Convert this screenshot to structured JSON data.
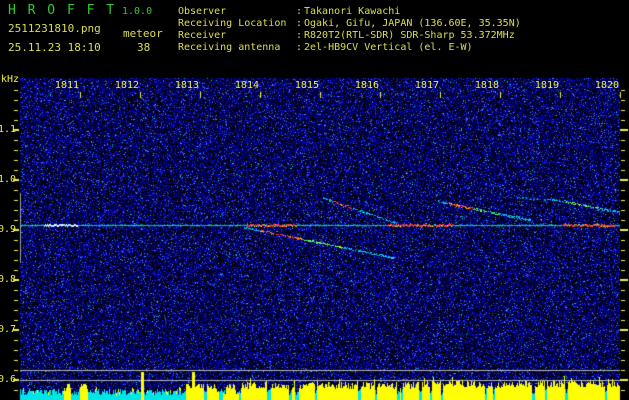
{
  "header": {
    "app_title": "H R O F F T",
    "version": "1.0.0",
    "filename": "2511231810.png",
    "mode_label": "meteor",
    "timestamp": "25.11.23 18:10",
    "meteor_count": "38",
    "separator": ":",
    "station_info": [
      {
        "label": "Observer",
        "value": "Takanori Kawachi"
      },
      {
        "label": "Receiving Location",
        "value": "Ogaki, Gifu, JAPAN (136.60E, 35.35N)"
      },
      {
        "label": "Receiver",
        "value": "R820T2(RTL-SDR) SDR-Sharp 53.372MHz"
      },
      {
        "label": "Receiving antenna",
        "value": "2el-HB9CV Vertical (el. E-W)"
      }
    ]
  },
  "colors": {
    "title_green": "#2ecc2e",
    "text_yellow": "#dddd55",
    "axis_yellow": "#f0f040",
    "background": "#000000",
    "carrier_cyan": "#00c8d2",
    "level_line_gray": "#b4b4b4",
    "left_marker_gray": "#9aa2aa",
    "amplitude_noise_cyan": "#00e6e6",
    "amplitude_activity_yellow": "#ffff00"
  },
  "chart_data": {
    "type": "heatmap",
    "x_axis": {
      "tick_labels": [
        "1811",
        "1812",
        "1813",
        "1814",
        "1815",
        "1816",
        "1817",
        "1818",
        "1819",
        "1820"
      ],
      "start_time": "18:10",
      "end_time": "18:20",
      "minutes_total": 10
    },
    "y_axis": {
      "unit_label": "kHz",
      "tick_labels": [
        "1.1",
        "1.0",
        "0.9",
        "0.8",
        "0.7",
        "0.6"
      ],
      "tick_values": [
        1.1,
        1.0,
        0.9,
        0.8,
        0.7,
        0.6
      ],
      "minor_step_khz": 0.02,
      "top_khz": 1.204,
      "bottom_khz": 0.556
    },
    "carrier": {
      "freq_khz": 0.91,
      "bright_segments": [
        {
          "t_start": 0.4,
          "t_end": 0.95,
          "style": "white"
        },
        {
          "t_start": 3.77,
          "t_end": 4.6,
          "style": "hot"
        },
        {
          "t_start": 6.13,
          "t_end": 7.2,
          "style": "hot"
        },
        {
          "t_start": 9.05,
          "t_end": 9.9,
          "style": "hot"
        }
      ]
    },
    "echo_traces": [
      {
        "id": "A",
        "t_start": 5.05,
        "f_start_khz": 0.964,
        "t_end": 6.28,
        "f_end_khz": 0.914,
        "faint": false,
        "hot_spans": [
          {
            "t_start": 5.2,
            "t_end": 5.55,
            "color": "red"
          }
        ]
      },
      {
        "id": "B",
        "t_start": 3.72,
        "f_start_khz": 0.906,
        "t_end": 6.25,
        "f_end_khz": 0.844,
        "faint": false,
        "hot_spans": [
          {
            "t_start": 3.97,
            "t_end": 4.67,
            "color": "red"
          },
          {
            "t_start": 4.67,
            "t_end": 5.4,
            "color": "green"
          }
        ]
      },
      {
        "id": "C",
        "t_start": 6.95,
        "f_start_khz": 0.958,
        "t_end": 8.5,
        "f_end_khz": 0.92,
        "faint": false,
        "hot_spans": [
          {
            "t_start": 7.13,
            "t_end": 7.53,
            "color": "red"
          },
          {
            "t_start": 7.53,
            "t_end": 8.0,
            "color": "green"
          }
        ]
      },
      {
        "id": "D",
        "t_start": 8.78,
        "f_start_khz": 0.964,
        "t_end": 10.0,
        "f_end_khz": 0.936,
        "faint": false,
        "hot_spans": [
          {
            "t_start": 9.08,
            "t_end": 9.67,
            "color": "green"
          },
          {
            "t_start": 9.45,
            "t_end": 9.62,
            "color": "red"
          }
        ]
      },
      {
        "id": "E",
        "t_start": 8.28,
        "f_start_khz": 0.966,
        "t_end": 8.78,
        "f_end_khz": 0.959,
        "faint": true,
        "hot_spans": []
      }
    ],
    "level_lines_khz": [
      0.62,
      0.6
    ],
    "left_marker": {
      "t_min": 0,
      "f_top_khz": 0.974,
      "f_bottom_khz": 0.834
    },
    "amplitude_plot": {
      "yellow_envelope": [
        [
          0.0,
          0.73,
          0.05
        ],
        [
          0.73,
          0.85,
          0.35
        ],
        [
          0.85,
          1.0,
          0.06
        ],
        [
          1.0,
          1.12,
          0.35
        ],
        [
          1.12,
          2.7,
          0.05
        ],
        [
          2.7,
          3.25,
          0.55
        ],
        [
          3.25,
          3.42,
          0.15
        ],
        [
          3.42,
          3.58,
          0.5
        ],
        [
          3.58,
          3.66,
          0.1
        ],
        [
          3.66,
          6.8,
          0.6
        ],
        [
          6.8,
          7.6,
          0.72
        ],
        [
          7.6,
          8.3,
          0.62
        ],
        [
          8.3,
          9.3,
          0.75
        ],
        [
          9.3,
          10.0,
          0.68
        ]
      ],
      "spikes": [
        {
          "t": 0.8,
          "h": 0.45
        },
        {
          "t": 1.07,
          "h": 0.45
        },
        {
          "t": 2.03,
          "h": 1.0
        },
        {
          "t": 2.88,
          "h": 1.0
        }
      ]
    }
  }
}
